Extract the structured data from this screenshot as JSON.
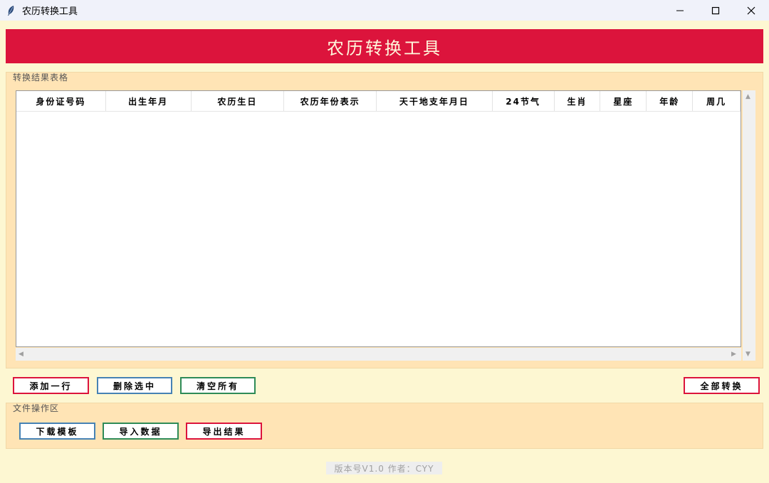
{
  "window": {
    "title": "农历转换工具",
    "controls": [
      "minimize-icon",
      "maximize-icon",
      "close-icon"
    ]
  },
  "banner": {
    "title": "农历转换工具"
  },
  "table_section": {
    "label": "转换结果表格",
    "columns": [
      "身份证号码",
      "出生年月",
      "农历生日",
      "农历年份表示",
      "天干地支年月日",
      "24节气",
      "生肖",
      "星座",
      "年龄",
      "周几"
    ],
    "rows": []
  },
  "actions": {
    "add_row": "添加一行",
    "delete_selected": "删除选中",
    "clear_all": "清空所有",
    "convert_all": "全部转换"
  },
  "file_section": {
    "label": "文件操作区",
    "download_template": "下载模板",
    "import_data": "导入数据",
    "export_results": "导出结果"
  },
  "footer": {
    "version_text": "版本号V1.0  作者：CYY"
  },
  "colors": {
    "banner_bg": "#dc143c",
    "banner_text": "#fff8dc",
    "window_bg": "#fdf7d2",
    "frame_bg": "#ffe4b5",
    "btn_red": "#dc143c",
    "btn_blue": "#4682b4",
    "btn_green": "#2e8b57"
  }
}
